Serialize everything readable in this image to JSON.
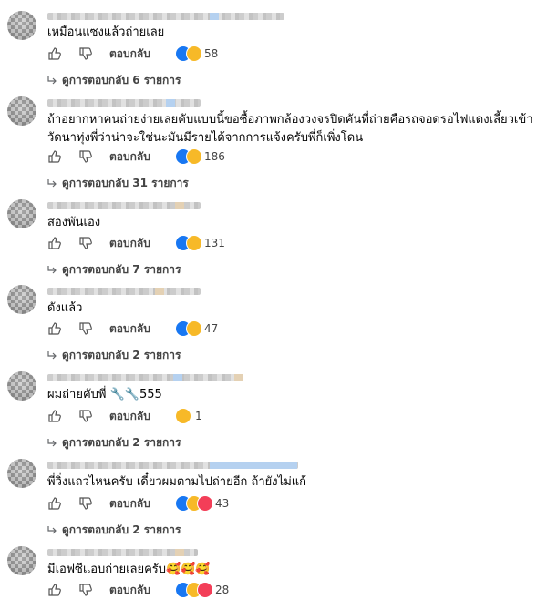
{
  "reply_label": "ตอบกลับ",
  "colors": {
    "like": "#1877f2",
    "haha": "#f7b928",
    "love": "#f33e58",
    "muted": "#65676b"
  },
  "comments": [
    {
      "text": "เหมือนแซงแล้วถ่ายเลย",
      "reaction_count": "58",
      "reactions": [
        "like-icon",
        "haha-icon"
      ],
      "view_replies": "ดูการตอบกลับ 6 รายการ"
    },
    {
      "text_line1": "ถ้าอยากหาคนถ่ายง่ายเลยคับแบบนี้ขอซื้อภาพกล้องวงจรปิดคันที่ถ่ายคือรถจอดรอไฟแดงเลี้ยวเข้า",
      "text_line2": "วัดนาทุ่งพี่ว่าน่าจะใช่นะมันมีรายได้จากการแจ้งครับพี่ก็เพิ่งโดน",
      "reaction_count": "186",
      "reactions": [
        "like-icon",
        "haha-icon"
      ],
      "view_replies": "ดูการตอบกลับ 31 รายการ"
    },
    {
      "text": "สองพันเอง",
      "reaction_count": "131",
      "reactions": [
        "like-icon",
        "haha-icon"
      ],
      "view_replies": "ดูการตอบกลับ 7 รายการ"
    },
    {
      "text": "ดังแล้ว",
      "reaction_count": "47",
      "reactions": [
        "like-icon",
        "haha-icon"
      ],
      "view_replies": "ดูการตอบกลับ 2 รายการ"
    },
    {
      "text": "ผมถ่ายคับพี่ 🔧🔧555",
      "reaction_count": "1",
      "reactions": [
        "haha-icon"
      ],
      "view_replies": "ดูการตอบกลับ 2 รายการ"
    },
    {
      "text": "พี่วิ่งแถวไหนครับ เดี๋ยวผมตามไปถ่ายอีก ถ้ายังไม่แก้",
      "reaction_count": "43",
      "reactions": [
        "like-icon",
        "haha-icon",
        "love-icon"
      ],
      "view_replies": "ดูการตอบกลับ 2 รายการ"
    },
    {
      "text": "มีเอฟซีแอบถ่ายเลยครับ🥰🥰🥰",
      "reaction_count": "28",
      "reactions": [
        "like-icon",
        "haha-icon",
        "love-icon"
      ]
    }
  ]
}
